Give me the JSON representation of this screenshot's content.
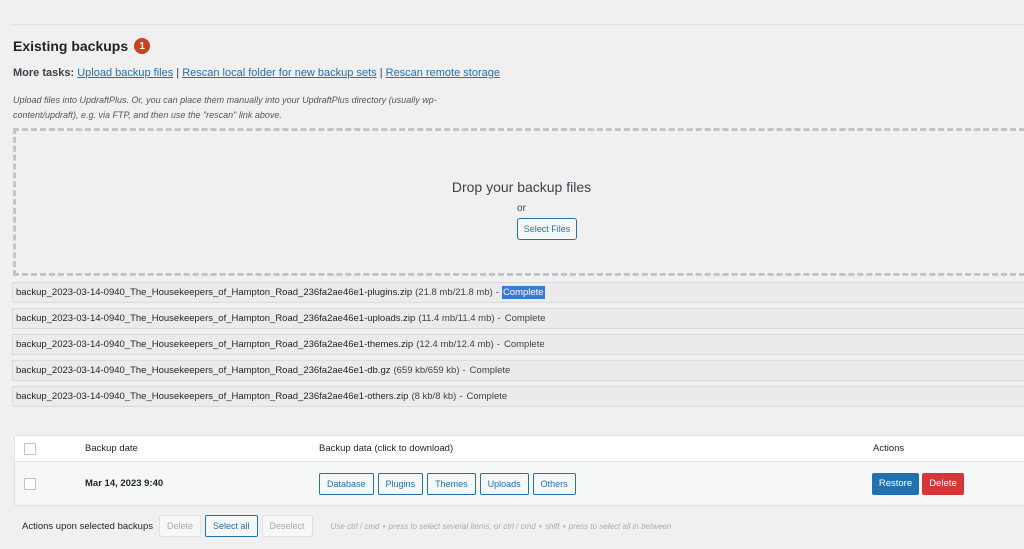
{
  "section": {
    "title": "Existing backups",
    "badge_count": "1"
  },
  "more_tasks": {
    "label": "More tasks:",
    "links": [
      "Upload backup files",
      "Rescan local folder for new backup sets",
      "Rescan remote storage"
    ],
    "separator": "|"
  },
  "upload_hint": "Upload files into UpdraftPlus. Or, you can place them manually into your UpdraftPlus directory (usually wp-content/updraft), e.g. via FTP, and then use the \"rescan\" link above.",
  "dropzone": {
    "title": "Drop your backup files",
    "or_text": "or",
    "select_button": "Select Files"
  },
  "uploaded_files": [
    {
      "name": "backup_2023-03-14-0940_The_Housekeepers_of_Hampton_Road_236fa2ae46e1-plugins.zip",
      "size": "(21.8 mb/21.8 mb)",
      "dash": "-",
      "status": "Complete",
      "highlighted": true
    },
    {
      "name": "backup_2023-03-14-0940_The_Housekeepers_of_Hampton_Road_236fa2ae46e1-uploads.zip",
      "size": "(11.4 mb/11.4 mb)",
      "dash": "-",
      "status": "Complete",
      "highlighted": false
    },
    {
      "name": "backup_2023-03-14-0940_The_Housekeepers_of_Hampton_Road_236fa2ae46e1-themes.zip",
      "size": "(12.4 mb/12.4 mb)",
      "dash": "-",
      "status": "Complete",
      "highlighted": false
    },
    {
      "name": "backup_2023-03-14-0940_The_Housekeepers_of_Hampton_Road_236fa2ae46e1-db.gz",
      "size": "(659 kb/659 kb)",
      "dash": "-",
      "status": "Complete",
      "highlighted": false
    },
    {
      "name": "backup_2023-03-14-0940_The_Housekeepers_of_Hampton_Road_236fa2ae46e1-others.zip",
      "size": "(8 kb/8 kb)",
      "dash": "-",
      "status": "Complete",
      "highlighted": false
    }
  ],
  "table": {
    "headers": {
      "date": "Backup date",
      "data": "Backup data (click to download)",
      "actions": "Actions"
    },
    "rows": [
      {
        "date": "Mar 14, 2023 9:40",
        "downloads": [
          "Database",
          "Plugins",
          "Themes",
          "Uploads",
          "Others"
        ],
        "restore_label": "Restore",
        "delete_label": "Delete"
      }
    ]
  },
  "bulk": {
    "label": "Actions upon selected backups",
    "delete": "Delete",
    "select_all": "Select all",
    "deselect": "Deselect",
    "hint": "Use ctrl / cmd + press to select several items, or ctrl / cmd + shift + press to select all in between"
  },
  "colors": {
    "accent": "#2271b1",
    "danger": "#d63638",
    "badge": "#c9411e",
    "highlight": "#3b79d8"
  }
}
